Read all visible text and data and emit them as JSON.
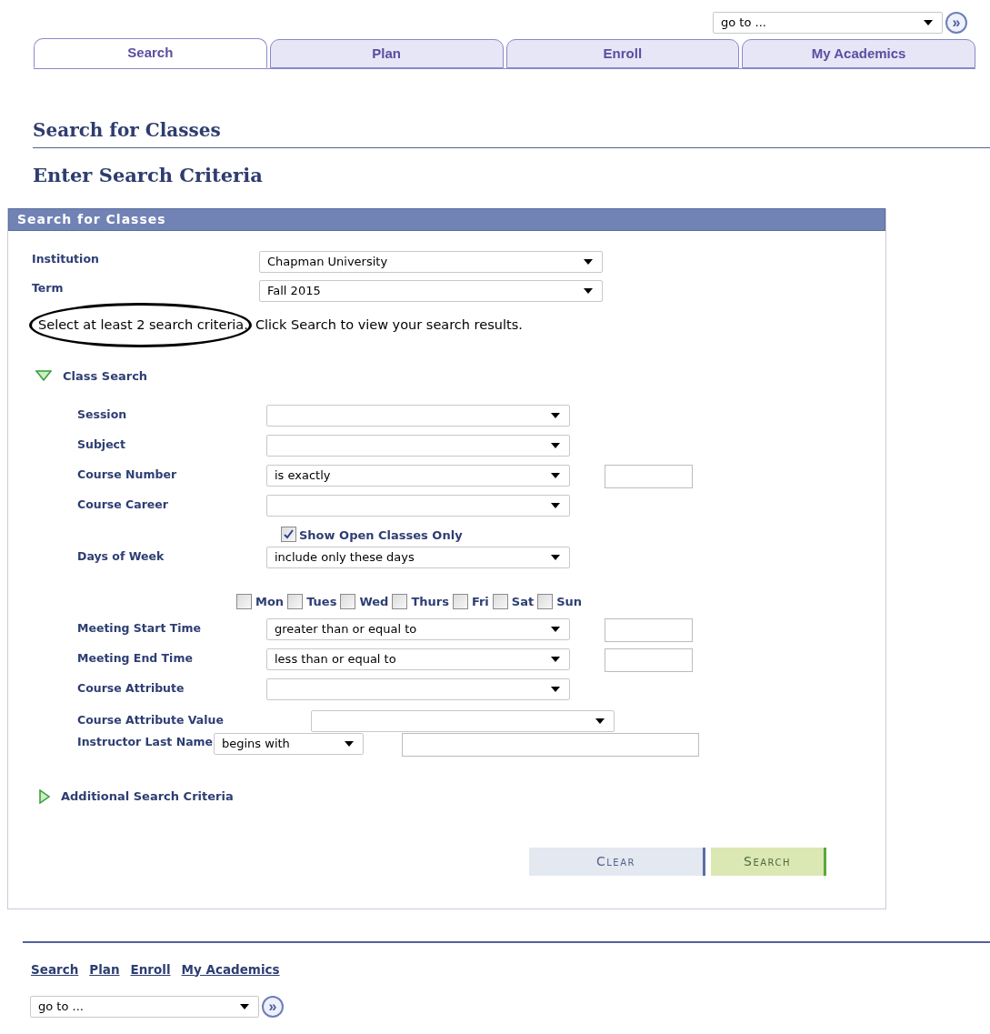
{
  "top_nav": {
    "goto": "go to ...",
    "go_button": "»"
  },
  "tabs": [
    {
      "label": "Search",
      "selected": true
    },
    {
      "label": "Plan",
      "selected": false
    },
    {
      "label": "Enroll",
      "selected": false
    },
    {
      "label": "My Academics",
      "selected": false
    }
  ],
  "page_title": "Search for Classes",
  "subtitle": "Enter Search Criteria",
  "panel": {
    "title": "Search for Classes",
    "top_fields": [
      {
        "label": "Institution",
        "value": "Chapman University"
      },
      {
        "label": "Term",
        "value": "Fall 2015"
      }
    ],
    "instruction_highlighted": "Select at least 2 search criteria.",
    "instruction_rest": "Click Search to view your search results.",
    "class_search": {
      "label": "Class Search",
      "expanded": true
    },
    "fields": [
      {
        "kind": "select",
        "label": "Session"
      },
      {
        "kind": "select",
        "label": "Subject"
      },
      {
        "kind": "select_input",
        "label": "Course Number",
        "value": "is exactly"
      },
      {
        "kind": "select",
        "label": "Course Career"
      },
      {
        "kind": "checkbox",
        "label": "Show Open Classes Only",
        "checked": true
      },
      {
        "kind": "select",
        "label": "Days of Week",
        "value": "include only these days"
      },
      {
        "kind": "days",
        "days": [
          {
            "label": "Mon",
            "checked": false
          },
          {
            "label": "Tues",
            "checked": false
          },
          {
            "label": "Wed",
            "checked": false
          },
          {
            "label": "Thurs",
            "checked": false
          },
          {
            "label": "Fri",
            "checked": false
          },
          {
            "label": "Sat",
            "checked": false
          },
          {
            "label": "Sun",
            "checked": false
          }
        ]
      },
      {
        "kind": "select_input",
        "label": "Meeting Start Time",
        "value": "greater than or equal to"
      },
      {
        "kind": "select_input",
        "label": "Meeting End Time",
        "value": "less than or equal to"
      },
      {
        "kind": "select",
        "label": "Course Attribute"
      },
      {
        "kind": "select_wide",
        "label": "Course Attribute Value"
      },
      {
        "kind": "select_short",
        "label": "Instructor Last Name",
        "value": "begins with"
      }
    ],
    "additional": {
      "label": "Additional Search Criteria",
      "expanded": false
    },
    "buttons": [
      {
        "kind": "clear",
        "label": "Clear"
      },
      {
        "kind": "search",
        "label": "Search"
      }
    ]
  },
  "footer_links": [
    "Search",
    "Plan",
    "Enroll",
    "My Academics"
  ],
  "footer_nav": {
    "goto": "go to ...",
    "go_button": "»"
  }
}
